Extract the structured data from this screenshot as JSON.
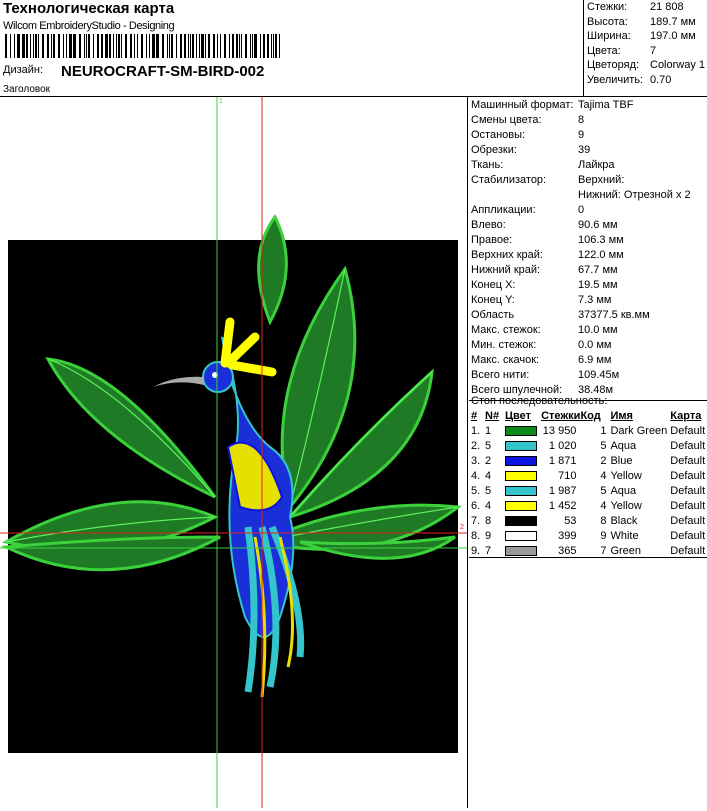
{
  "header": {
    "title": "Технологическая карта",
    "subtitle": "Wilcom EmbroideryStudio - Designing",
    "design_label": "Дизайн:",
    "design_name": "NEUROCRAFT-SM-BIRD-002",
    "heading_label": "Заголовок"
  },
  "stats": [
    {
      "k": "Стежки:",
      "v": "21 808"
    },
    {
      "k": "Высота:",
      "v": "189.7 мм"
    },
    {
      "k": "Ширина:",
      "v": "197.0 мм"
    },
    {
      "k": "Цвета:",
      "v": "7"
    },
    {
      "k": "Цветоряд:",
      "v": "Colorway 1"
    },
    {
      "k": "Увеличить:",
      "v": "0.70"
    }
  ],
  "info": [
    {
      "k": "Машинный формат:",
      "v": "Tajima TBF"
    },
    {
      "k": "Смены цвета:",
      "v": "8"
    },
    {
      "k": "Остановы:",
      "v": "9"
    },
    {
      "k": "Обрезки:",
      "v": "39"
    },
    {
      "k": "Ткань:",
      "v": "Лайкра"
    },
    {
      "k": "Стабилизатор:",
      "v": "Верхний:",
      "v2": "Нижний: Отрезной x 2"
    },
    {
      "k": "Аппликации:",
      "v": "0"
    },
    {
      "k": "Влево:",
      "v": "90.6 мм"
    },
    {
      "k": "Правое:",
      "v": "106.3 мм"
    },
    {
      "k": "Верхних край:",
      "v": "122.0 мм"
    },
    {
      "k": "Нижний край:",
      "v": "67.7 мм"
    },
    {
      "k": "Конец X:",
      "v": "19.5 мм"
    },
    {
      "k": "Конец Y:",
      "v": "7.3 мм"
    },
    {
      "k": "Область",
      "v": "37377.5 кв.мм"
    },
    {
      "k": "Макс. стежок:",
      "v": "10.0 мм"
    },
    {
      "k": "Мин. стежок:",
      "v": "0.0 мм"
    },
    {
      "k": "Макс. скачок:",
      "v": "6.9 мм"
    },
    {
      "k": "Всего нити:",
      "v": "109.45м"
    },
    {
      "k": "Всего шпулечной:",
      "v": "38.48м"
    }
  ],
  "sequence": {
    "title": "Стоп последовательность:",
    "columns": [
      "#",
      "N#",
      "Цвет",
      "Стежки",
      "Код",
      "Имя",
      "Карта"
    ],
    "rows": [
      {
        "i": "1.",
        "n": "1",
        "color": "#0a8a1a",
        "st": "13 950",
        "code": "1",
        "name": "Dark Green",
        "map": "Default"
      },
      {
        "i": "2.",
        "n": "5",
        "color": "#33c4cc",
        "st": "1 020",
        "code": "5",
        "name": "Aqua",
        "map": "Default"
      },
      {
        "i": "3.",
        "n": "2",
        "color": "#0a14e0",
        "st": "1 871",
        "code": "2",
        "name": "Blue",
        "map": "Default"
      },
      {
        "i": "4.",
        "n": "4",
        "color": "#ffff00",
        "st": "710",
        "code": "4",
        "name": "Yellow",
        "map": "Default"
      },
      {
        "i": "5.",
        "n": "5",
        "color": "#33c4cc",
        "st": "1 987",
        "code": "5",
        "name": "Aqua",
        "map": "Default"
      },
      {
        "i": "6.",
        "n": "4",
        "color": "#ffff00",
        "st": "1 452",
        "code": "4",
        "name": "Yellow",
        "map": "Default"
      },
      {
        "i": "7.",
        "n": "8",
        "color": "#000000",
        "st": "53",
        "code": "8",
        "name": "Black",
        "map": "Default"
      },
      {
        "i": "8.",
        "n": "9",
        "color": "#ffffff",
        "st": "399",
        "code": "9",
        "name": "White",
        "map": "Default"
      },
      {
        "i": "9.",
        "n": "7",
        "color": "#999999",
        "st": "365",
        "code": "7",
        "name": "Green",
        "map": "Default"
      }
    ]
  },
  "canvas": {
    "marker1": "1",
    "marker2": "2"
  }
}
